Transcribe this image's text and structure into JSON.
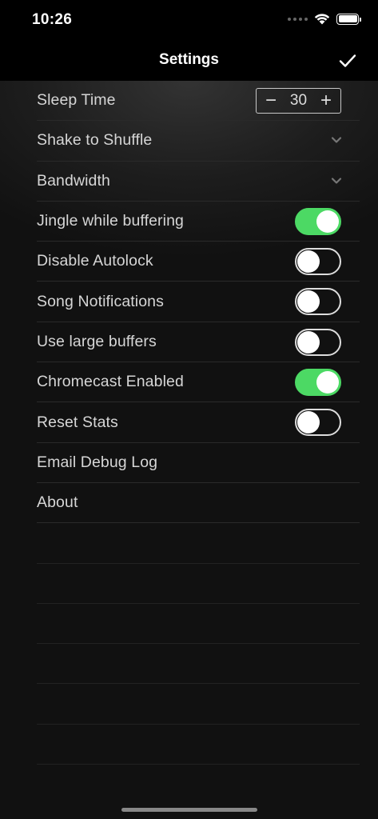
{
  "status_bar": {
    "time": "10:26"
  },
  "nav": {
    "title": "Settings",
    "done_icon": "checkmark-icon"
  },
  "settings": {
    "sleep_time": {
      "label": "Sleep Time",
      "value": "30",
      "minus": "−",
      "plus": "+"
    },
    "shake_to_shuffle": {
      "label": "Shake to Shuffle"
    },
    "bandwidth": {
      "label": "Bandwidth"
    },
    "jingle_while_buffering": {
      "label": "Jingle while buffering",
      "on": true
    },
    "disable_autolock": {
      "label": "Disable Autolock",
      "on": false
    },
    "song_notifications": {
      "label": "Song Notifications",
      "on": false
    },
    "use_large_buffers": {
      "label": "Use large buffers",
      "on": false
    },
    "chromecast_enabled": {
      "label": "Chromecast Enabled",
      "on": true
    },
    "reset_stats": {
      "label": "Reset Stats",
      "on": false
    },
    "email_debug_log": {
      "label": "Email Debug Log"
    },
    "about": {
      "label": "About"
    }
  },
  "colors": {
    "toggle_on": "#4cd964",
    "background": "#000000",
    "text": "#d6d6d6"
  }
}
